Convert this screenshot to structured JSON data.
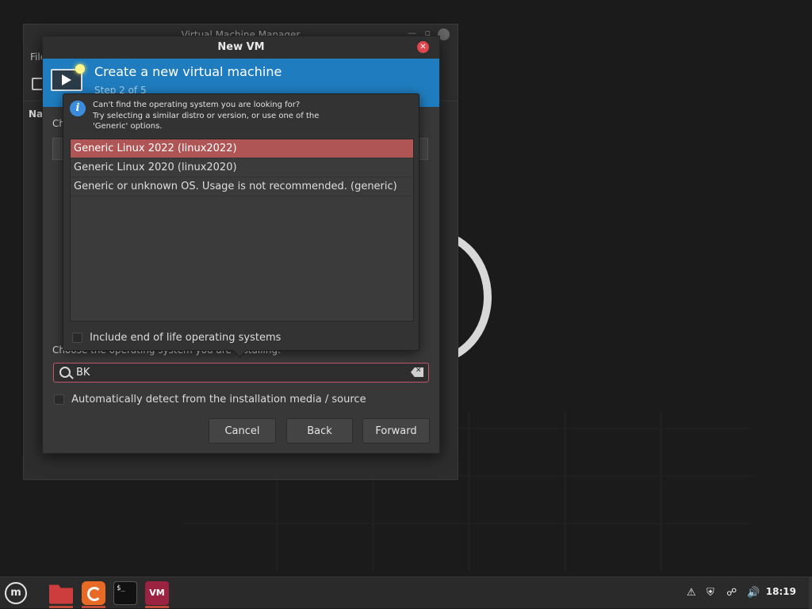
{
  "background_window": {
    "title": "Virtual Machine Manager",
    "menu_first": "File",
    "column_header": "Na"
  },
  "dialog": {
    "title": "New VM",
    "banner_title": "Create a new virtual machine",
    "banner_step": "Step 2 of 5",
    "partial_label_top": "Ch",
    "choose_label": "Choose the operating system you are installing:",
    "search_value": "BK",
    "auto_detect_label": "Automatically detect from the installation media / source",
    "buttons": {
      "cancel": "Cancel",
      "back": "Back",
      "forward": "Forward"
    }
  },
  "popover": {
    "info_line1": "Can't find the operating system you are looking for?",
    "info_line2": "Try selecting a similar distro or version, or use one of the",
    "info_line3": "'Generic' options.",
    "os_items": [
      {
        "label": "Generic Linux 2022 (linux2022)",
        "selected": true
      },
      {
        "label": "Generic Linux 2020 (linux2020)",
        "selected": false
      },
      {
        "label": "Generic or unknown OS. Usage is not recommended. (generic)",
        "selected": false
      }
    ],
    "eol_label": "Include end of life operating systems"
  },
  "taskbar": {
    "clock": "18:19",
    "apps": [
      "files-icon",
      "firefox-icon",
      "terminal-icon",
      "virt-manager-icon"
    ],
    "vm_app_text": "VM",
    "terminal_text": "$_"
  },
  "colors": {
    "accent_blue": "#1f7dbf",
    "selection_red": "#b05555",
    "close_red": "#e0474c"
  }
}
